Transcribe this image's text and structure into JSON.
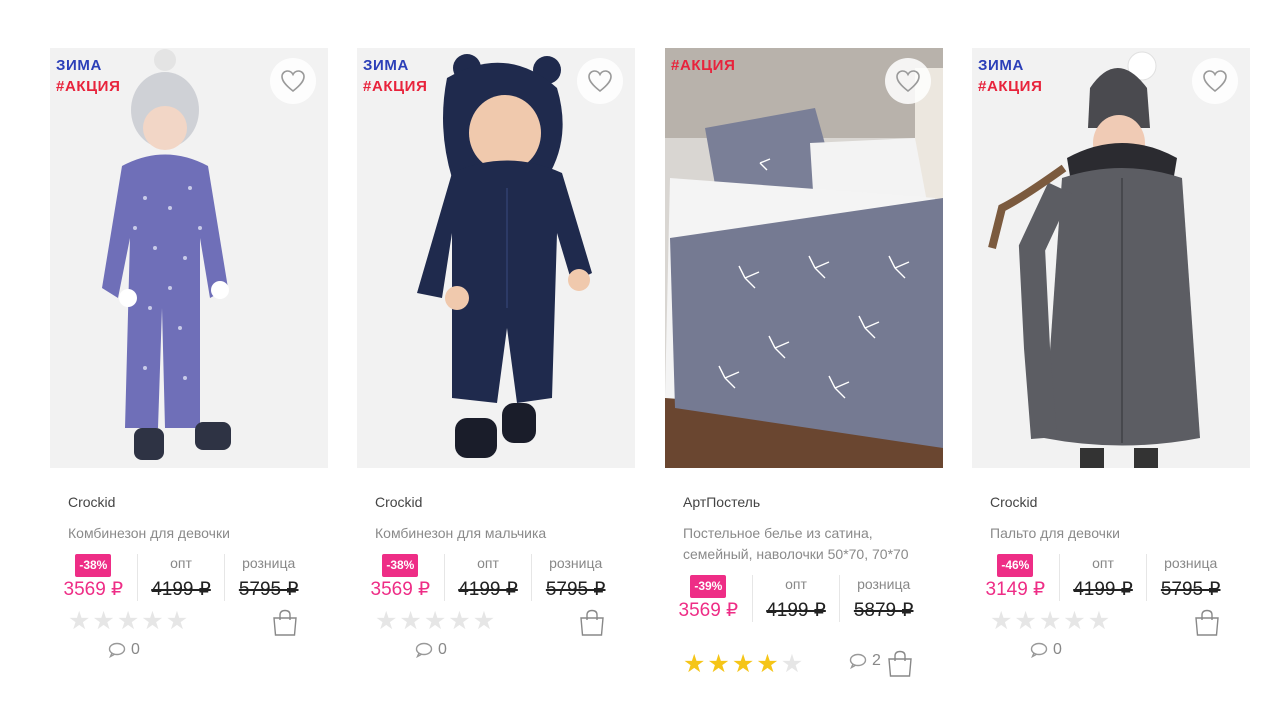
{
  "currency_symbol": "₽",
  "labels": {
    "wholesale": "опт",
    "retail": "розница"
  },
  "colors": {
    "sale": "#ee2d86",
    "season_tag": "#2b3fb8",
    "promo_tag": "#e8233c",
    "star_on": "#f5c518",
    "star_off": "#e6e6e6"
  },
  "products": [
    {
      "season_tag": "ЗИМА",
      "promo_tag": "#АКЦИЯ",
      "brand": "Crockid",
      "name": "Комбинезон для девочки",
      "discount": "-38%",
      "price": "3569 ₽",
      "wholesale": "4199 ₽",
      "retail": "5795 ₽",
      "rating": 0,
      "comments": "0",
      "icons": [
        "heart-icon",
        "star-icon",
        "comment-icon",
        "bag-icon"
      ]
    },
    {
      "season_tag": "ЗИМА",
      "promo_tag": "#АКЦИЯ",
      "brand": "Crockid",
      "name": "Комбинезон для мальчика",
      "discount": "-38%",
      "price": "3569 ₽",
      "wholesale": "4199 ₽",
      "retail": "5795 ₽",
      "rating": 0,
      "comments": "0",
      "icons": [
        "heart-icon",
        "star-icon",
        "comment-icon",
        "bag-icon"
      ]
    },
    {
      "season_tag": "",
      "promo_tag": "#АКЦИЯ",
      "brand": "АртПостель",
      "name": "Постельное белье из сатина, семейный, наволочки 50*70, 70*70",
      "discount": "-39%",
      "price": "3569 ₽",
      "wholesale": "4199 ₽",
      "retail": "5879 ₽",
      "rating": 4,
      "comments": "2",
      "icons": [
        "heart-icon",
        "star-icon",
        "comment-icon",
        "bag-icon"
      ]
    },
    {
      "season_tag": "ЗИМА",
      "promo_tag": "#АКЦИЯ",
      "brand": "Crockid",
      "name": "Пальто для девочки",
      "discount": "-46%",
      "price": "3149 ₽",
      "wholesale": "4199 ₽",
      "retail": "5795 ₽",
      "rating": 0,
      "comments": "0",
      "icons": [
        "heart-icon",
        "star-icon",
        "comment-icon",
        "bag-icon"
      ]
    }
  ]
}
